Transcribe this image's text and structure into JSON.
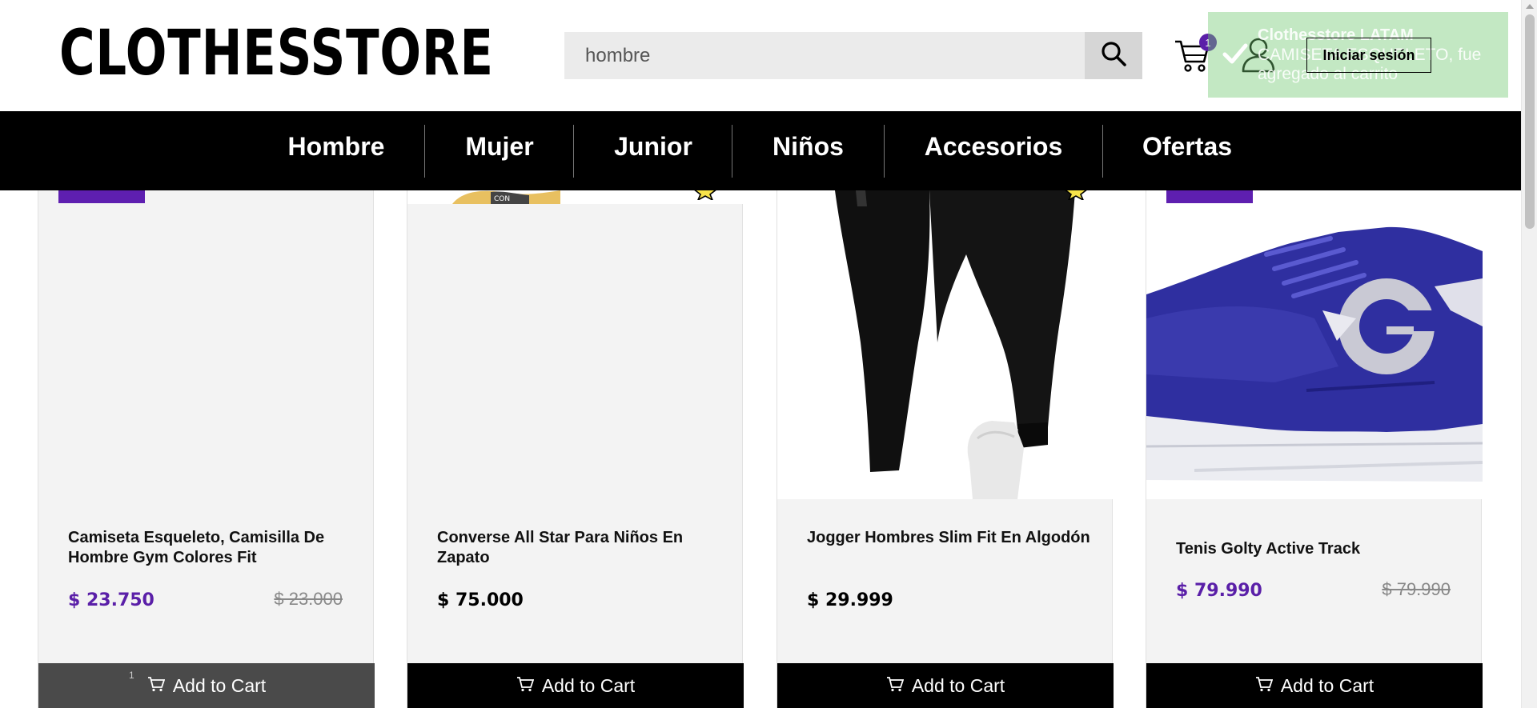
{
  "header": {
    "logo": "CLOTHESSTORE",
    "search_value": "hombre",
    "cart_count": "1",
    "login_label": "Iniciar sesión"
  },
  "toast": {
    "title": "Clothesstore LATAM",
    "message": "CAMISETA ESQUELETO, fue agregado al carrito"
  },
  "nav": {
    "items": [
      "Hombre",
      "Mujer",
      "Junior",
      "Niños",
      "Accesorios",
      "Ofertas"
    ]
  },
  "products": [
    {
      "name": "Camiseta Esqueleto, Camisilla De Hombre Gym Colores Fit",
      "price": "$ 23.750",
      "old_price": "$ 23.000",
      "button": "Add to Cart",
      "qty": "1"
    },
    {
      "name": "Converse All Star Para Niños En Zapato",
      "price": "$ 75.000",
      "button": "Add to Cart"
    },
    {
      "name": "Jogger Hombres Slim Fit En Algodón",
      "price": "$ 29.999",
      "button": "Add to Cart"
    },
    {
      "name": "Tenis Golty Active Track",
      "price": "$ 79.990",
      "old_price": "$ 79.990",
      "button": "Add to Cart"
    }
  ],
  "colors": {
    "accent": "#5a1fa8",
    "nav_bg": "#000000",
    "card_bg": "#f3f3f3",
    "toast_bg": "#70c870"
  },
  "icons": {
    "search": "search-icon",
    "cart": "cart-icon",
    "user": "user-icon",
    "check": "check-icon",
    "star": "star-icon"
  }
}
